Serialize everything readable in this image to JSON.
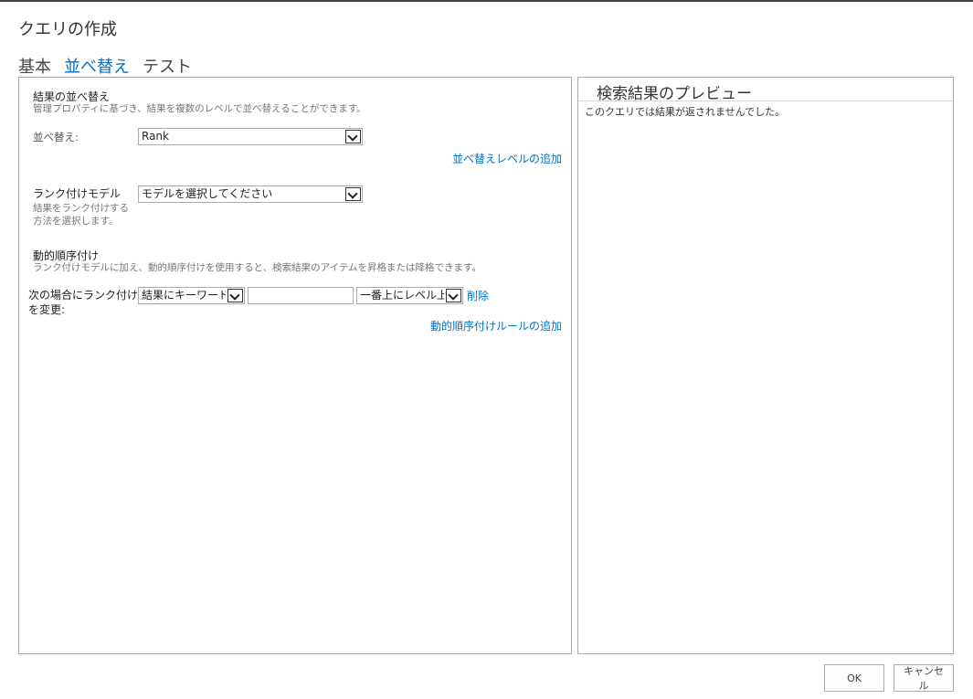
{
  "dialog": {
    "title": "クエリの作成"
  },
  "tabs": [
    {
      "label": "基本",
      "active": false
    },
    {
      "label": "並べ替え",
      "active": true
    },
    {
      "label": "テスト",
      "active": false
    }
  ],
  "sort": {
    "title": "結果の並べ替え",
    "description": "管理プロパティに基づき、結果を複数のレベルで並べ替えることができます。",
    "sort_label": "並べ替え:",
    "sort_value": "Rank",
    "add_level_link": "並べ替えレベルの追加"
  },
  "ranking": {
    "label": "ランク付けモデル",
    "description_line1": "結果をランク付けする",
    "description_line2": "方法を選択します。",
    "model_value": "モデルを選択してください"
  },
  "dynamic": {
    "title": "動的順序付け",
    "description": "ランク付けモデルに加え、動的順序付けを使用すると、検索結果のアイテムを昇格または降格できます。",
    "rule_label_line1": "次の場合にランク付け",
    "rule_label_line2": "を変更:",
    "condition_value": "結果にキーワードが",
    "keyword_value": "",
    "action_value": "一番上にレベル上げ",
    "delete_link": "削除",
    "add_rule_link": "動的順序付けルールの追加"
  },
  "preview": {
    "title": "検索結果のプレビュー",
    "message": "このクエリでは結果が返されませんでした。"
  },
  "footer": {
    "ok_label": "OK",
    "cancel_label": "キャンセル"
  },
  "colors": {
    "accent": "#0072c6",
    "border": "#ababab"
  }
}
